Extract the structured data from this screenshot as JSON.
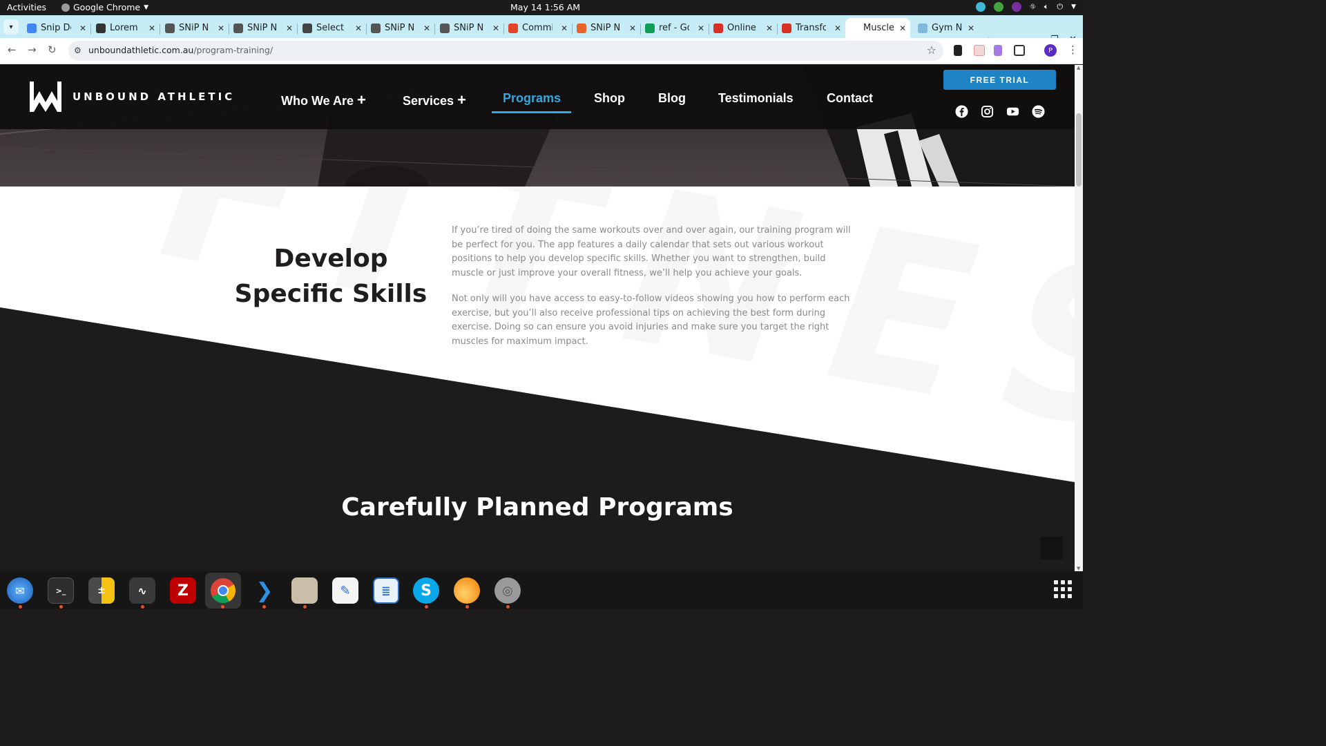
{
  "system": {
    "activities_label": "Activities",
    "app_name": "Google Chrome",
    "clock": "May 14  1:56 AM"
  },
  "browser": {
    "tabs": [
      {
        "title": "Snip De",
        "favicon_color": "#4285f4"
      },
      {
        "title": "Lorem I",
        "favicon_color": "#333333"
      },
      {
        "title": "SNiP Nu",
        "favicon_color": "#555555"
      },
      {
        "title": "SNiP Nu",
        "favicon_color": "#555555"
      },
      {
        "title": "Select p",
        "favicon_color": "#444444"
      },
      {
        "title": "SNiP Nu",
        "favicon_color": "#555555"
      },
      {
        "title": "SNiP Nu",
        "favicon_color": "#555555"
      },
      {
        "title": "Commi",
        "favicon_color": "#e24329"
      },
      {
        "title": "SNiP Nu",
        "favicon_color": "#e8632b"
      },
      {
        "title": "ref - Go",
        "favicon_color": "#0f9d58"
      },
      {
        "title": "Online",
        "favicon_color": "#d93025"
      },
      {
        "title": "Transfo",
        "favicon_color": "#d93025"
      },
      {
        "title": "Muscle",
        "favicon_color": "#ffffff"
      },
      {
        "title": "Gym Nu",
        "favicon_color": "#7fb8d8"
      }
    ],
    "active_tab_index": 12,
    "url": {
      "domain": "unboundathletic.com.au",
      "path": "/program-training/"
    },
    "profile_initial": "P"
  },
  "site": {
    "brand": "UNBOUND ATHLETIC",
    "menu": [
      {
        "label": "Who We Are",
        "has_submenu": true
      },
      {
        "label": "Services",
        "has_submenu": true
      },
      {
        "label": "Programs",
        "active": true
      },
      {
        "label": "Shop"
      },
      {
        "label": "Blog"
      },
      {
        "label": "Testimonials"
      },
      {
        "label": "Contact"
      }
    ],
    "cta": "FREE TRIAL",
    "socials": [
      "facebook-icon",
      "instagram-icon",
      "youtube-icon",
      "spotify-icon"
    ],
    "accent_color": "#34a8e0",
    "cta_color": "#1f84c4",
    "watermark": "FITNESS",
    "section1": {
      "heading": "Develop Specific Skills",
      "paragraphs": [
        "If you’re tired of doing the same workouts over and over again, our training program will be perfect for you. The app features a daily calendar that sets out various workout positions to help you develop specific skills. Whether you want to strengthen, build muscle or just improve your overall fitness, we’ll help you achieve your goals.",
        "Not only will you have access to easy-to-follow videos showing you how to perform each exercise, but you’ll also receive professional tips on achieving the best form during exercise. Doing so can ensure you avoid injuries and make sure you target the right muscles for maximum impact."
      ]
    },
    "section2": {
      "heading": "Carefully Planned Programs"
    }
  },
  "dock": {
    "apps": [
      "thunderbird-icon",
      "terminal-icon",
      "calculator-icon",
      "system-monitor-icon",
      "filezilla-icon",
      "chrome-icon",
      "vscode-icon",
      "files-icon",
      "text-editor-icon",
      "writer-icon",
      "skype-icon",
      "blender-icon",
      "disks-icon"
    ]
  }
}
